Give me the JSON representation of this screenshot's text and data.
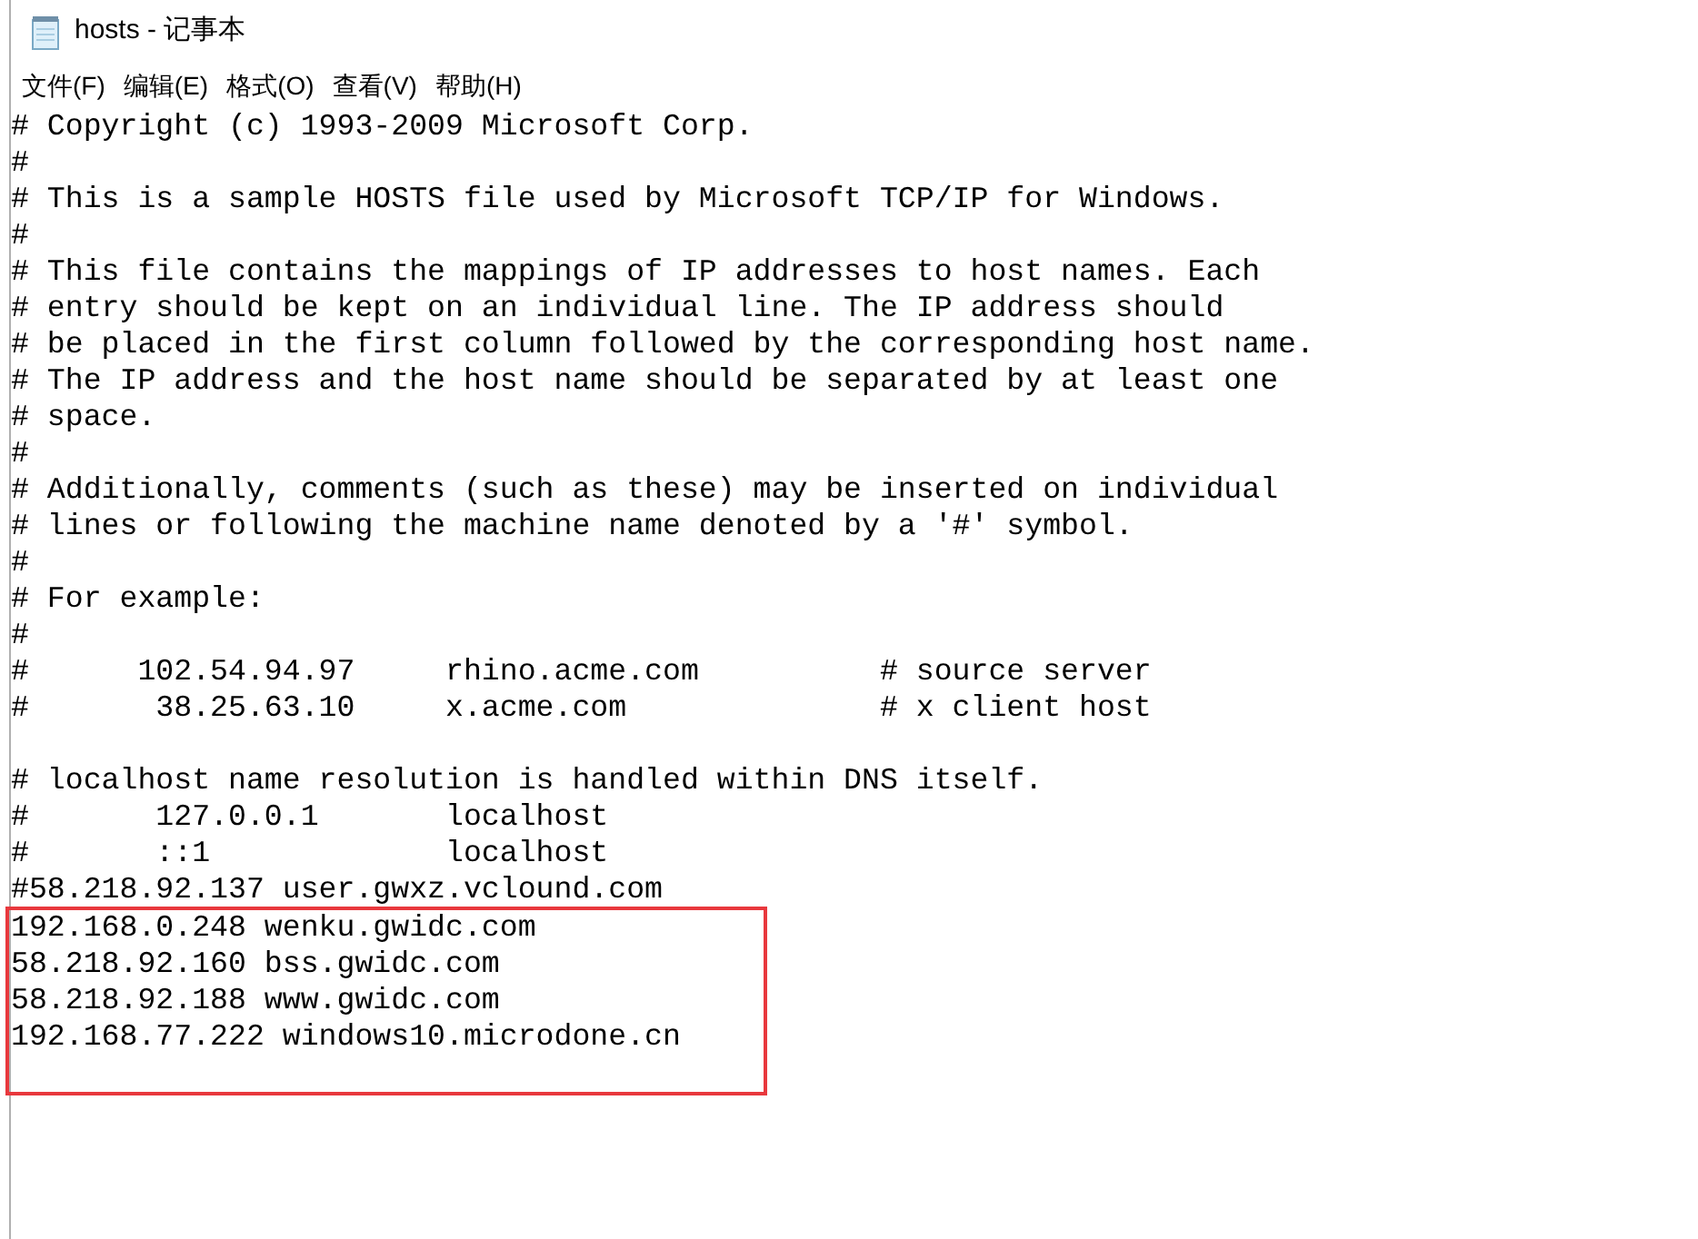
{
  "window": {
    "title": "hosts - 记事本"
  },
  "menu": [
    "文件(F)",
    "编辑(E)",
    "格式(O)",
    "查看(V)",
    "帮助(H)"
  ],
  "blocks": [
    {
      "boxed": false,
      "lines": [
        "# Copyright (c) 1993-2009 Microsoft Corp.",
        "#",
        "# This is a sample HOSTS file used by Microsoft TCP/IP for Windows.",
        "#",
        "# This file contains the mappings of IP addresses to host names. Each",
        "# entry should be kept on an individual line. The IP address should",
        "# be placed in the first column followed by the corresponding host name.",
        "# The IP address and the host name should be separated by at least one",
        "# space.",
        "#",
        "# Additionally, comments (such as these) may be inserted on individual",
        "# lines or following the machine name denoted by a '#' symbol.",
        "#",
        "# For example:",
        "#",
        "#      102.54.94.97     rhino.acme.com          # source server",
        "#       38.25.63.10     x.acme.com              # x client host"
      ]
    },
    {
      "boxed": false,
      "lines": [
        "# localhost name resolution is handled within DNS itself.",
        "#       127.0.0.1       localhost",
        "#       ::1             localhost",
        "#58.218.92.137 user.gwxz.vclound.com"
      ]
    },
    {
      "boxed": true,
      "lines": [
        "192.168.0.248 wenku.gwidc.com",
        "58.218.92.160 bss.gwidc.com",
        "58.218.92.188 www.gwidc.com",
        "192.168.77.222 windows10.microdone.cn"
      ]
    }
  ]
}
